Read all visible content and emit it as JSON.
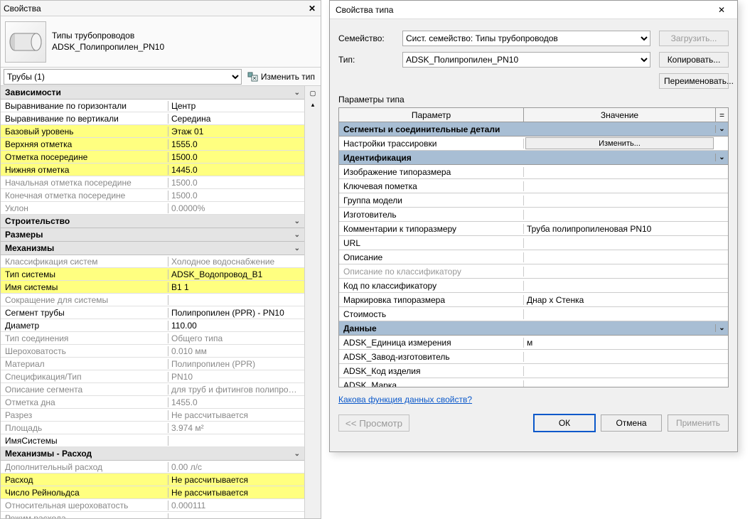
{
  "props": {
    "title": "Свойства",
    "family_line1": "Типы трубопроводов",
    "family_line2": "ADSK_Полипропилен_PN10",
    "selector": "Трубы (1)",
    "edit_type": "Изменить тип",
    "groups": {
      "deps": {
        "title": "Зависимости"
      },
      "build": {
        "title": "Строительство"
      },
      "dims": {
        "title": "Размеры"
      },
      "mech": {
        "title": "Механизмы"
      },
      "flow": {
        "title": "Механизмы - Расход"
      }
    },
    "rows": {
      "halign": {
        "n": "Выравнивание по горизонтали",
        "v": "Центр"
      },
      "valign": {
        "n": "Выравнивание по вертикали",
        "v": "Середина"
      },
      "base": {
        "n": "Базовый уровень",
        "v": "Этаж 01"
      },
      "top": {
        "n": "Верхняя отметка",
        "v": "1555.0"
      },
      "mid": {
        "n": "Отметка посередине",
        "v": "1500.0"
      },
      "bot": {
        "n": "Нижняя отметка",
        "v": "1445.0"
      },
      "startmid": {
        "n": "Начальная отметка посередине",
        "v": "1500.0"
      },
      "endmid": {
        "n": "Конечная отметка посередине",
        "v": "1500.0"
      },
      "slope": {
        "n": "Уклон",
        "v": "0.0000%"
      },
      "sysclass": {
        "n": "Классификация систем",
        "v": "Холодное водоснабжение"
      },
      "systype": {
        "n": "Тип системы",
        "v": "ADSK_Водопровод_В1"
      },
      "sysname": {
        "n": "Имя системы",
        "v": "В1 1"
      },
      "sysabbr": {
        "n": "Сокращение для системы",
        "v": ""
      },
      "segment": {
        "n": "Сегмент трубы",
        "v": "Полипропилен (PPR) - PN10"
      },
      "dia": {
        "n": "Диаметр",
        "v": "110.00"
      },
      "conn": {
        "n": "Тип соединения",
        "v": "Общего типа"
      },
      "rough": {
        "n": "Шероховатость",
        "v": "0.010 мм"
      },
      "mat": {
        "n": "Материал",
        "v": "Полипропилен (PPR)"
      },
      "spec": {
        "n": "Спецификация/Тип",
        "v": "PN10"
      },
      "segdesc": {
        "n": "Описание сегмента",
        "v": "для труб и фитингов полипропиле..."
      },
      "bottomel": {
        "n": "Отметка дна",
        "v": "1455.0"
      },
      "section": {
        "n": "Разрез",
        "v": "Не рассчитывается"
      },
      "area": {
        "n": "Площадь",
        "v": "3.974 м²"
      },
      "sysnameP": {
        "n": "ИмяСистемы",
        "v": ""
      },
      "addflow": {
        "n": "Дополнительный расход",
        "v": "0.00 л/с"
      },
      "flow": {
        "n": "Расход",
        "v": "Не рассчитывается"
      },
      "reynolds": {
        "n": "Число Рейнольдса",
        "v": "Не рассчитывается"
      },
      "relrough": {
        "n": "Относительная шероховатость",
        "v": "0.000111"
      },
      "flowmode": {
        "n": "Режим расхода",
        "v": ""
      }
    }
  },
  "dlg": {
    "title": "Свойства типа",
    "family_label": "Семейство:",
    "family_value": "Сист. семейство: Типы трубопроводов",
    "type_label": "Тип:",
    "type_value": "ADSK_Полипропилен_PN10",
    "load": "Загрузить...",
    "copy": "Копировать...",
    "rename": "Переименовать...",
    "param_heading": "Параметры типа",
    "col_param": "Параметр",
    "col_value": "Значение",
    "col_eq": "=",
    "groups": {
      "seg": "Сегменты и соединительные детали",
      "ident": "Идентификация",
      "data": "Данные"
    },
    "rows": {
      "routing": {
        "n": "Настройки трассировки",
        "btn": "Изменить..."
      },
      "typeimg": {
        "n": "Изображение типоразмера",
        "v": ""
      },
      "key": {
        "n": "Ключевая пометка",
        "v": ""
      },
      "mgroup": {
        "n": "Группа модели",
        "v": ""
      },
      "mfr": {
        "n": "Изготовитель",
        "v": ""
      },
      "typcom": {
        "n": "Комментарии к типоразмеру",
        "v": "Труба полипропиленовая PN10"
      },
      "url": {
        "n": "URL",
        "v": ""
      },
      "desc": {
        "n": "Описание",
        "v": ""
      },
      "classdesc": {
        "n": "Описание по классификатору",
        "v": ""
      },
      "classcode": {
        "n": "Код по классификатору",
        "v": ""
      },
      "typemark": {
        "n": "Маркировка типоразмера",
        "v": "Днар x Стенка"
      },
      "cost": {
        "n": "Стоимость",
        "v": ""
      },
      "unit": {
        "n": "ADSK_Единица измерения",
        "v": "м"
      },
      "plant": {
        "n": "ADSK_Завод-изготовитель",
        "v": ""
      },
      "code": {
        "n": "ADSK_Код изделия",
        "v": ""
      },
      "mark": {
        "n": "ADSK_Марка",
        "v": ""
      }
    },
    "help": "Какова функция данных свойств?",
    "preview": "<< Просмотр",
    "ok": "ОК",
    "cancel": "Отмена",
    "apply": "Применить"
  }
}
